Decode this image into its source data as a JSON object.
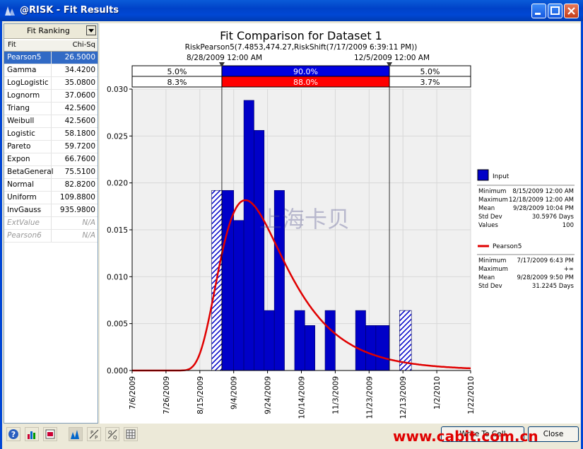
{
  "window": {
    "title": "@RISK - Fit Results"
  },
  "watermark": {
    "site": "www.cabit.com.cn",
    "chinese": "上海卡贝"
  },
  "left": {
    "ranking_label": "Fit Ranking",
    "col_fit": "Fit",
    "col_stat": "Chi-Sq",
    "rows": [
      {
        "name": "Pearson5",
        "value": "26.5000"
      },
      {
        "name": "Gamma",
        "value": "34.4200"
      },
      {
        "name": "LogLogistic",
        "value": "35.0800"
      },
      {
        "name": "Lognorm",
        "value": "37.0600"
      },
      {
        "name": "Triang",
        "value": "42.5600"
      },
      {
        "name": "Weibull",
        "value": "42.5600"
      },
      {
        "name": "Logistic",
        "value": "58.1800"
      },
      {
        "name": "Pareto",
        "value": "59.7200"
      },
      {
        "name": "Expon",
        "value": "66.7600"
      },
      {
        "name": "BetaGeneral",
        "value": "75.5100"
      },
      {
        "name": "Normal",
        "value": "82.8200"
      },
      {
        "name": "Uniform",
        "value": "109.8800"
      },
      {
        "name": "InvGauss",
        "value": "935.9800"
      },
      {
        "name": "ExtValue",
        "value": "N/A"
      },
      {
        "name": "Pearson6",
        "value": "N/A"
      }
    ]
  },
  "chart_header": {
    "title": "Fit Comparison for Dataset 1",
    "subtitle": "RiskPearson5(7.4853,474.27,RiskShift(7/17/2009 6:39:11 PM))",
    "left_marker": "8/28/2009 12:00 AM",
    "right_marker": "12/5/2009 12:00 AM",
    "band1": [
      "5.0%",
      "90.0%",
      "5.0%"
    ],
    "band2": [
      "8.3%",
      "88.0%",
      "3.7%"
    ]
  },
  "legend": {
    "input_label": "Input",
    "input_stats": [
      {
        "k": "Minimum",
        "v": "8/15/2009 12:00 AM"
      },
      {
        "k": "Maximum",
        "v": "12/18/2009 12:00 AM"
      },
      {
        "k": "Mean",
        "v": "9/28/2009 10:04 PM"
      },
      {
        "k": "Std Dev",
        "v": "30.5976 Days"
      },
      {
        "k": "Values",
        "v": "100"
      }
    ],
    "fit_label": "Pearson5",
    "fit_stats": [
      {
        "k": "Minimum",
        "v": "7/17/2009 6:43 PM"
      },
      {
        "k": "Maximum",
        "v": "+∞"
      },
      {
        "k": "Mean",
        "v": "9/28/2009 9:50 PM"
      },
      {
        "k": "Std Dev",
        "v": "31.2245 Days"
      }
    ]
  },
  "colors": {
    "bar": "#0000c8",
    "curve": "#e00000",
    "band_mid1": "#0000e0",
    "band_mid2": "#ff0000"
  },
  "chart_data": {
    "type": "bar",
    "ylim": [
      0,
      0.03
    ],
    "xlim": [
      "2009-07-06",
      "2010-01-22"
    ],
    "y_ticks": [
      "0.000",
      "0.005",
      "0.010",
      "0.015",
      "0.020",
      "0.025",
      "0.030"
    ],
    "x_ticks": [
      "7/6/2009",
      "7/26/2009",
      "8/15/2009",
      "9/4/2009",
      "9/24/2009",
      "10/14/2009",
      "11/3/2009",
      "11/23/2009",
      "12/13/2009",
      "1/2/2010",
      "1/22/2010"
    ],
    "bins": [
      {
        "start": "2009-08-15",
        "end": "2009-08-22",
        "density": 0.0
      },
      {
        "start": "2009-08-22",
        "end": "2009-08-28",
        "density": 0.0192,
        "hatched": true
      },
      {
        "start": "2009-08-28",
        "end": "2009-09-04",
        "density": 0.0192
      },
      {
        "start": "2009-09-04",
        "end": "2009-09-10",
        "density": 0.016
      },
      {
        "start": "2009-09-10",
        "end": "2009-09-16",
        "density": 0.0288
      },
      {
        "start": "2009-09-16",
        "end": "2009-09-22",
        "density": 0.0256
      },
      {
        "start": "2009-09-22",
        "end": "2009-09-28",
        "density": 0.0064
      },
      {
        "start": "2009-09-28",
        "end": "2009-10-04",
        "density": 0.0192
      },
      {
        "start": "2009-10-04",
        "end": "2009-10-10",
        "density": 0.0
      },
      {
        "start": "2009-10-10",
        "end": "2009-10-16",
        "density": 0.0064
      },
      {
        "start": "2009-10-16",
        "end": "2009-10-22",
        "density": 0.0048
      },
      {
        "start": "2009-10-22",
        "end": "2009-10-28",
        "density": 0.0
      },
      {
        "start": "2009-10-28",
        "end": "2009-11-03",
        "density": 0.0064
      },
      {
        "start": "2009-11-03",
        "end": "2009-11-09",
        "density": 0.0
      },
      {
        "start": "2009-11-09",
        "end": "2009-11-15",
        "density": 0.0
      },
      {
        "start": "2009-11-15",
        "end": "2009-11-21",
        "density": 0.0064
      },
      {
        "start": "2009-11-21",
        "end": "2009-11-27",
        "density": 0.0048
      },
      {
        "start": "2009-11-27",
        "end": "2009-12-05",
        "density": 0.0048
      },
      {
        "start": "2009-12-05",
        "end": "2009-12-11",
        "density": 0.0
      },
      {
        "start": "2009-12-11",
        "end": "2009-12-18",
        "density": 0.0064,
        "hatched": true
      }
    ],
    "series": [
      {
        "name": "Input"
      },
      {
        "name": "Pearson5",
        "alpha": 7.4853,
        "beta": 474.27,
        "shift": "2009-07-17"
      }
    ]
  },
  "toolbar": {
    "write_label": "Write To Cell",
    "close_label": "Close"
  }
}
